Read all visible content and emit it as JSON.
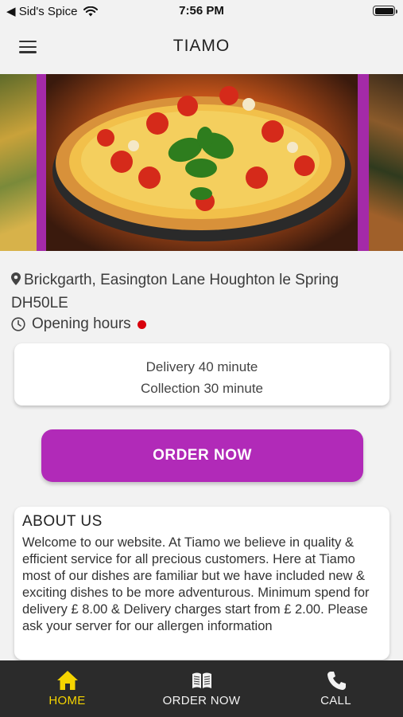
{
  "status_bar": {
    "back_label": "◀ Sid's Spice",
    "time": "7:56 PM"
  },
  "nav": {
    "title": "TIAMO"
  },
  "hero": {
    "image": "pizza-banner-image"
  },
  "location": {
    "address": "Brickgarth, Easington Lane  Houghton le Spring DH50LE",
    "hours_label": "Opening hours",
    "status_color": "#d8000c"
  },
  "delivery": {
    "delivery_text": "Delivery 40 minute",
    "collection_text": "Collection 30 minute"
  },
  "order_button": {
    "label": "ORDER NOW",
    "color": "#b12ab8"
  },
  "about": {
    "title": "ABOUT US",
    "text": "Welcome to our website. At Tiamo we believe in quality & efficient service for all precious customers. Here at Tiamo most of our dishes are familiar but we have included new & exciting dishes to be more adventurous. Minimum spend for delivery £ 8.00 & Delivery charges start from £ 2.00. Please ask your server for our allergen information"
  },
  "tabs": [
    {
      "label": "HOME",
      "icon": "home-icon",
      "active": true
    },
    {
      "label": "ORDER NOW",
      "icon": "menu-book-icon",
      "active": false
    },
    {
      "label": "CALL",
      "icon": "phone-icon",
      "active": false
    }
  ],
  "colors": {
    "accent": "#b12ab8",
    "active_tab": "#f5d400",
    "tab_bar": "#2b2b2b"
  }
}
